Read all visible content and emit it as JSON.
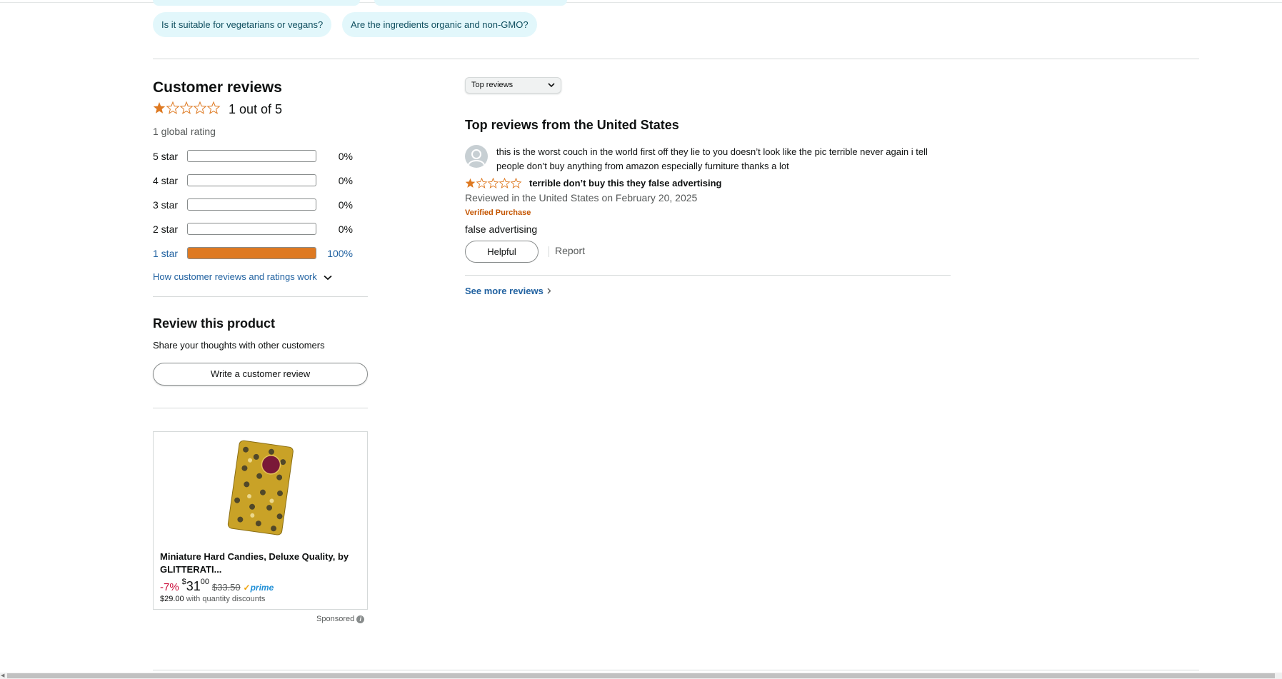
{
  "questions": {
    "chips": [
      "Is it suitable for vegetarians or vegans?",
      "Are the ingredients organic and non-GMO?"
    ]
  },
  "reviews_summary": {
    "title": "Customer reviews",
    "average_text": "1 out of 5",
    "average_stars": 1,
    "global_rating": "1 global rating",
    "histogram": [
      {
        "label": "5 star",
        "percent_text": "0%",
        "percent": 0
      },
      {
        "label": "4 star",
        "percent_text": "0%",
        "percent": 0
      },
      {
        "label": "3 star",
        "percent_text": "0%",
        "percent": 0
      },
      {
        "label": "2 star",
        "percent_text": "0%",
        "percent": 0
      },
      {
        "label": "1 star",
        "percent_text": "100%",
        "percent": 100
      }
    ],
    "how_link": "How customer reviews and ratings work"
  },
  "review_product": {
    "title": "Review this product",
    "subtitle": "Share your thoughts with other customers",
    "button": "Write a customer review"
  },
  "sponsored_ad": {
    "title": "Miniature Hard Candies, Deluxe Quality, by GLITTERATI...",
    "discount": "-7%",
    "currency": "$",
    "price_whole": "31",
    "price_fraction": "00",
    "list_price": "$33.50",
    "prime": "prime",
    "qty_price": "$29.00",
    "qty_text": "with quantity discounts",
    "sponsored_label": "Sponsored"
  },
  "sort": {
    "selected": "Top reviews"
  },
  "top_reviews": {
    "title": "Top reviews from the United States",
    "items": [
      {
        "author_text": "this is the worst couch in the world first off they lie to you doesn’t look like the pic terrible never again i tell people don’t buy anything from amazon especially furniture thanks a lot",
        "stars": 1,
        "title": "terrible don’t buy this they false advertising",
        "date": "Reviewed in the United States on February 20, 2025",
        "verified": "Verified Purchase",
        "body": "false advertising",
        "helpful": "Helpful",
        "report": "Report"
      }
    ],
    "see_more": "See more reviews"
  },
  "colors": {
    "star": "#de7921",
    "link": "#2162a1",
    "chip_bg": "#e2f7fb",
    "verified": "#c45500",
    "discount": "#cc0c39"
  }
}
